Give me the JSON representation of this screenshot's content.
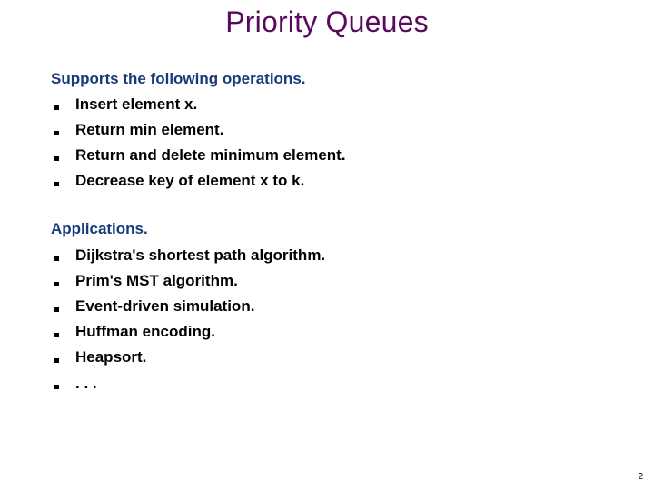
{
  "slide": {
    "title": "Priority Queues",
    "page_number": "2",
    "sections": [
      {
        "heading": "Supports the following operations.",
        "items": [
          "Insert element x.",
          "Return min element.",
          "Return and delete minimum element.",
          "Decrease key of element x to k."
        ]
      },
      {
        "heading": "Applications.",
        "items": [
          "Dijkstra's shortest path algorithm.",
          "Prim's MST algorithm.",
          "Event-driven simulation.",
          "Huffman encoding.",
          "Heapsort.",
          ". . ."
        ]
      }
    ],
    "colors": {
      "title": "#5a0a5c",
      "heading": "#173a7a",
      "text": "#000000"
    }
  }
}
